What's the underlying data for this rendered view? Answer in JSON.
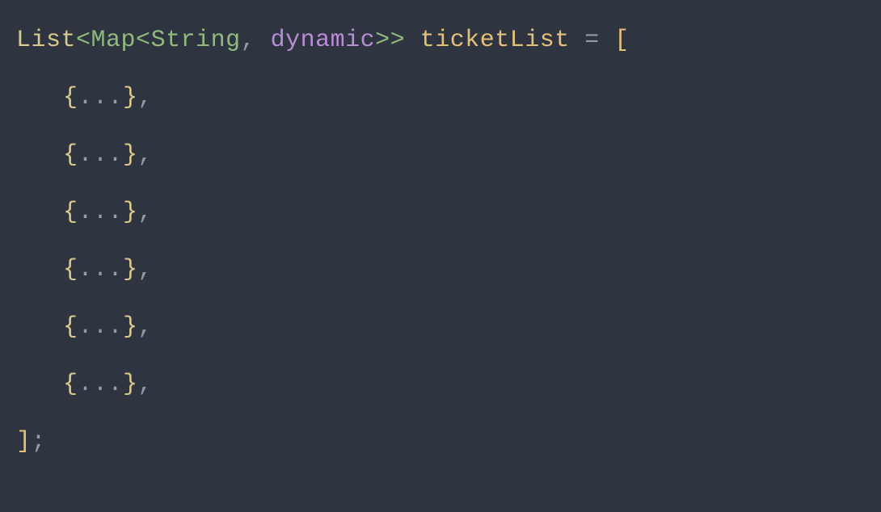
{
  "declaration": {
    "listType": "List",
    "angleOpen1": "<",
    "mapType": "Map",
    "angleOpen2": "<",
    "keyType": "String",
    "comma1": ",",
    "space1": " ",
    "valueType": "dynamic",
    "angleClose1": ">",
    "angleClose2": ">",
    "space2": " ",
    "varName": "ticketList",
    "space3": " ",
    "equals": "=",
    "space4": " ",
    "openBracket": "["
  },
  "collapsedEntries": [
    {
      "openBrace": "{",
      "ellipsis": "...",
      "closeBrace": "}",
      "comma": ","
    },
    {
      "openBrace": "{",
      "ellipsis": "...",
      "closeBrace": "}",
      "comma": ","
    },
    {
      "openBrace": "{",
      "ellipsis": "...",
      "closeBrace": "}",
      "comma": ","
    },
    {
      "openBrace": "{",
      "ellipsis": "...",
      "closeBrace": "}",
      "comma": ","
    },
    {
      "openBrace": "{",
      "ellipsis": "...",
      "closeBrace": "}",
      "comma": ","
    },
    {
      "openBrace": "{",
      "ellipsis": "...",
      "closeBrace": "}",
      "comma": ","
    }
  ],
  "closing": {
    "closeBracket": "]",
    "semicolon": ";"
  }
}
